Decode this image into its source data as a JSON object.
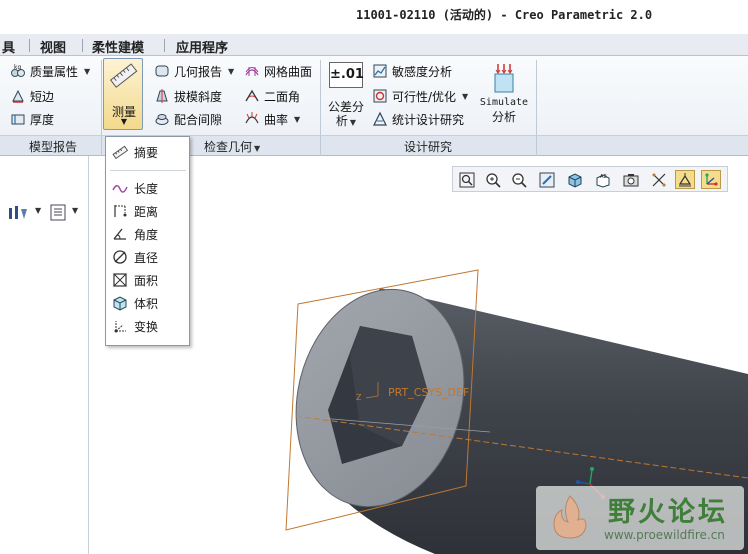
{
  "window": {
    "title": "11001-02110 (活动的) - Creo Parametric 2.0"
  },
  "tabs": [
    "具",
    "视图",
    "柔性建模",
    "应用程序"
  ],
  "ribbon": {
    "model_report": {
      "items": [
        "质量属性",
        "短边",
        "厚度"
      ],
      "group_label": "模型报告"
    },
    "measure": {
      "label": "测量"
    },
    "inspect_geometry": {
      "col1": [
        "几何报告",
        "拔模斜度",
        "配合间隙"
      ],
      "col2": [
        "网格曲面",
        "二面角",
        "曲率"
      ],
      "group_label": "检查几何"
    },
    "design_study": {
      "tolerance_icon_text": "±.01",
      "tolerance_line1": "公差分",
      "tolerance_line2": "析",
      "items": [
        "敏感度分析",
        "可行性/优化",
        "统计设计研究"
      ],
      "simulate_line1": "Simulate",
      "simulate_line2": "分析",
      "group_label": "设计研究"
    }
  },
  "measure_menu": {
    "items": [
      "摘要",
      "长度",
      "距离",
      "角度",
      "直径",
      "面积",
      "体积",
      "变换"
    ]
  },
  "viewport": {
    "csys_label": "PRT_CSYS_DEF"
  },
  "watermark": {
    "title": "野火论坛",
    "url": "www.proewildfire.cn"
  },
  "colors": {
    "accent_highlight": "#f5dc8c",
    "datum_orange": "#c07830",
    "part_gray": "#8e9299",
    "tab_bar": "#e8ecf2"
  }
}
